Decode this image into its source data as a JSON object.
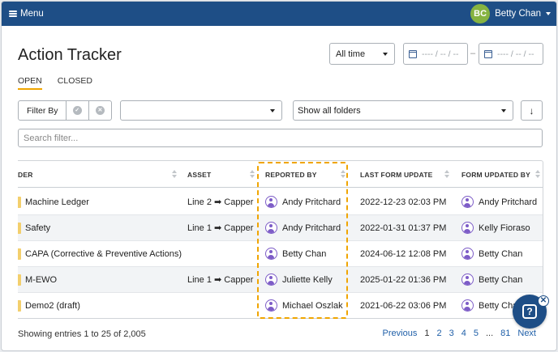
{
  "topbar": {
    "menu_label": "Menu",
    "user_initials": "BC",
    "user_name": "Betty Chan"
  },
  "page": {
    "title": "Action Tracker"
  },
  "time_filter": {
    "value": "All time"
  },
  "date_range": {
    "start_placeholder": "---- / -- / --",
    "end_placeholder": "---- / -- / --",
    "separator": "–"
  },
  "tabs": [
    {
      "label": "OPEN",
      "active": true
    },
    {
      "label": "CLOSED",
      "active": false
    }
  ],
  "filter": {
    "label": "Filter By",
    "check_icon": "✓",
    "clear_icon": "✕"
  },
  "dropdown1": {
    "value": ""
  },
  "folders": {
    "value": "Show all folders"
  },
  "sort_button": {
    "icon": "↓"
  },
  "search": {
    "placeholder": "Search filter..."
  },
  "table": {
    "headers": [
      "DER",
      "ASSET",
      "REPORTED BY",
      "LAST FORM UPDATE",
      "FORM UPDATED BY"
    ],
    "rows": [
      {
        "folder": "Machine Ledger",
        "asset": "Line 2 ➡ Capper",
        "reported_by": "Andy Pritchard",
        "last_update": "2022-12-23 02:03 PM",
        "updated_by": "Andy Pritchard"
      },
      {
        "folder": "Safety",
        "asset": "Line 1 ➡ Capper",
        "reported_by": "Andy Pritchard",
        "last_update": "2022-01-31 01:37 PM",
        "updated_by": "Kelly Fioraso"
      },
      {
        "folder": "CAPA (Corrective & Preventive Actions)",
        "asset": "",
        "reported_by": "Betty Chan",
        "last_update": "2024-06-12 12:08 PM",
        "updated_by": "Betty Chan"
      },
      {
        "folder": "M-EWO",
        "asset": "Line 1 ➡ Capper",
        "reported_by": "Juliette Kelly",
        "last_update": "2025-01-22 01:36 PM",
        "updated_by": "Betty Chan"
      },
      {
        "folder": "Demo2 (draft)",
        "asset": "",
        "reported_by": "Michael Oszlak",
        "last_update": "2021-06-22 03:06 PM",
        "updated_by": "Betty Chan"
      }
    ]
  },
  "footer": {
    "entries_text": "Showing entries 1 to 25 of 2,005"
  },
  "pagination": {
    "previous": "Previous",
    "pages": [
      "1",
      "2",
      "3",
      "4",
      "5"
    ],
    "ellipsis": "...",
    "last": "81",
    "next": "Next",
    "current": "1"
  },
  "help": {
    "icon": "?",
    "close_icon": "✕"
  },
  "colors": {
    "topbar": "#1e4e86",
    "accent": "#f0a500",
    "link": "#1f5fa8",
    "person_icon": "#7d5cc7",
    "avatar": "#86b341"
  }
}
